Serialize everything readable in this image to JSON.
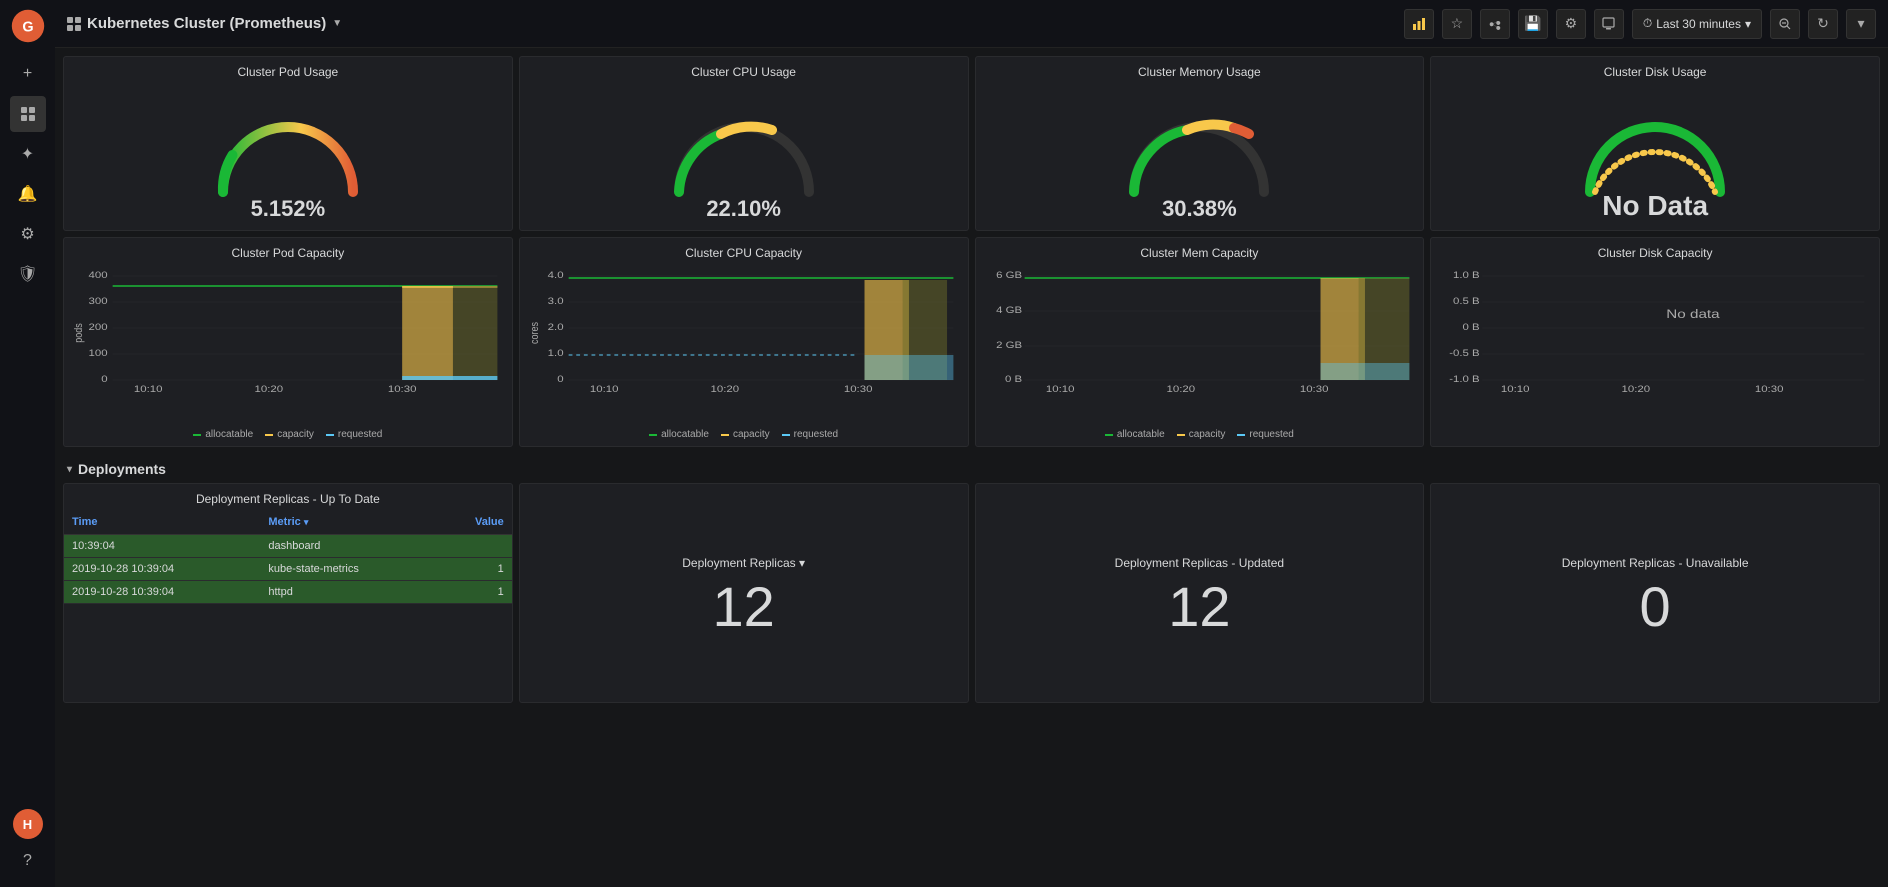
{
  "app": {
    "title": "Kubernetes Cluster (Prometheus)",
    "dropdown_arrow": "▼"
  },
  "topbar": {
    "time_range": "Last 30 minutes",
    "buttons": {
      "graph": "📊",
      "star": "☆",
      "share": "⬆",
      "save": "💾",
      "settings": "⚙",
      "display": "🖥",
      "zoom_out": "⊖",
      "search": "🔍",
      "refresh": "↻",
      "dropdown": "▾"
    }
  },
  "gauges": [
    {
      "title": "Cluster Pod Usage",
      "value": "5.152%",
      "color": "#1ab836",
      "pct": 5.152,
      "type": "gauge"
    },
    {
      "title": "Cluster CPU Usage",
      "value": "22.10%",
      "color": "#f8c84b",
      "pct": 22.1,
      "type": "gauge"
    },
    {
      "title": "Cluster Memory Usage",
      "value": "30.38%",
      "color": "#e05d35",
      "pct": 30.38,
      "type": "gauge"
    },
    {
      "title": "Cluster Disk Usage",
      "value": "No Data",
      "color": "#1ab836",
      "pct": 0,
      "type": "nodata"
    }
  ],
  "capacity_charts": [
    {
      "title": "Cluster Pod Capacity",
      "y_axis_label": "pods",
      "y_labels": [
        "400",
        "300",
        "200",
        "100",
        "0"
      ],
      "x_labels": [
        "10:10",
        "10:20",
        "10:30"
      ],
      "legend": [
        "allocatable",
        "capacity",
        "requested"
      ]
    },
    {
      "title": "Cluster CPU Capacity",
      "y_axis_label": "cores",
      "y_labels": [
        "4.0",
        "3.0",
        "2.0",
        "1.0",
        "0"
      ],
      "x_labels": [
        "10:10",
        "10:20",
        "10:30"
      ],
      "legend": [
        "allocatable",
        "capacity",
        "requested"
      ]
    },
    {
      "title": "Cluster Mem Capacity",
      "y_axis_label": "",
      "y_labels": [
        "6 GB",
        "4 GB",
        "2 GB",
        "0 B"
      ],
      "x_labels": [
        "10:10",
        "10:20",
        "10:30"
      ],
      "legend": [
        "allocatable",
        "capacity",
        "requested"
      ]
    },
    {
      "title": "Cluster Disk Capacity",
      "y_axis_label": "",
      "y_labels": [
        "1.0 B",
        "0.5 B",
        "0 B",
        "-0.5 B",
        "-1.0 B"
      ],
      "x_labels": [
        "10:10",
        "10:20",
        "10:30"
      ],
      "no_data_text": "No data",
      "legend": []
    }
  ],
  "deployments_section": {
    "label": "Deployments",
    "chevron": "▾"
  },
  "deployment_panels": [
    {
      "title": "Deployment Replicas - Up To Date",
      "type": "table",
      "columns": [
        "Time",
        "Metric",
        "Value"
      ],
      "rows": [
        {
          "time": "10:39:04",
          "metric": "dashboard",
          "value": "",
          "highlight": true
        },
        {
          "time": "2019-10-28 10:39:04",
          "metric": "kube-state-metrics",
          "value": "1",
          "highlight": true
        },
        {
          "time": "2019-10-28 10:39:04",
          "metric": "httpd",
          "value": "1",
          "highlight": true
        }
      ]
    },
    {
      "title": "Deployment Replicas ▾",
      "type": "big",
      "value": "12"
    },
    {
      "title": "Deployment Replicas - Updated",
      "type": "big",
      "value": "12"
    },
    {
      "title": "Deployment Replicas - Unavailable",
      "type": "big",
      "value": "0"
    }
  ],
  "colors": {
    "allocatable": "#1ab836",
    "capacity": "#f8c84b",
    "requested": "#5bc8f5",
    "bg_panel": "#1e1f23",
    "bg_dark": "#111217",
    "accent_blue": "#5b9cf6",
    "accent_green": "#2a5a2a"
  }
}
